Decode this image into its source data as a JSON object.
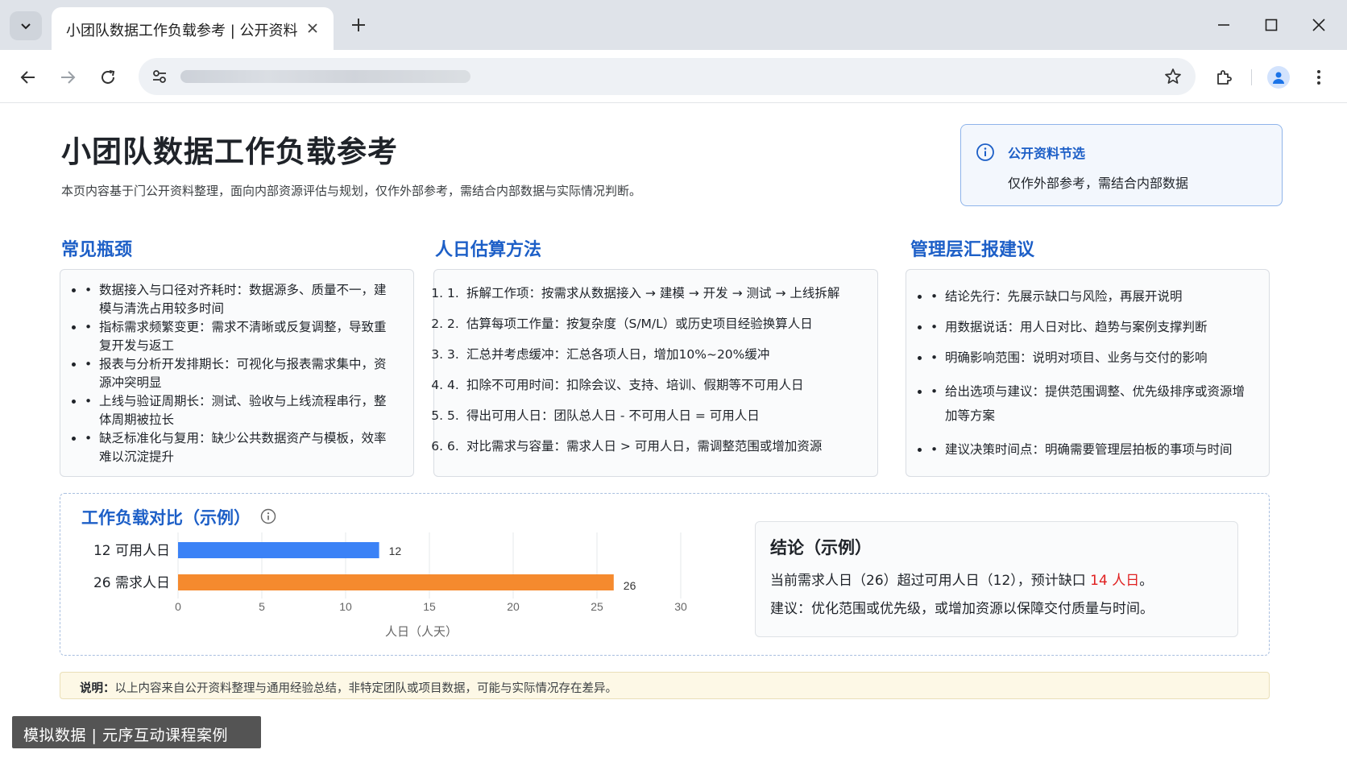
{
  "browser": {
    "tab_title": "小团队数据工作负载参考 | 公开资料",
    "icons": {
      "tab_search": "chevron-down-icon",
      "close_tab": "close-icon",
      "new_tab": "plus-icon",
      "back": "arrow-left-icon",
      "forward": "arrow-right-icon",
      "reload": "reload-icon",
      "site_info": "tune-icon",
      "bookmark": "star-icon",
      "extensions": "puzzle-icon",
      "profile": "person-icon",
      "menu": "more-vertical-icon",
      "minimize": "minimize-icon",
      "maximize": "maximize-icon",
      "close_window": "close-icon"
    }
  },
  "page": {
    "title": "小团队数据工作负载参考",
    "subtitle": "本页内容基于门公开资料整理，面向内部资源评估与规划，仅作外部参考，需结合内部数据与实际情况判断。",
    "info_box": {
      "heading": "公开资料节选",
      "text": "仅作外部参考，需结合内部数据"
    }
  },
  "sections": {
    "bottlenecks": {
      "title": "常见瓶颈",
      "items": [
        "数据接入与口径对齐耗时：数据源多、质量不一，建模与清洗占用较多时间",
        "指标需求频繁变更：需求不清晰或反复调整，导致重复开发与返工",
        "报表与分析开发排期长：可视化与报表需求集中，资源冲突明显",
        "上线与验证周期长：测试、验收与上线流程串行，整体周期被拉长",
        "缺乏标准化与复用：缺少公共数据资产与模板，效率难以沉淀提升"
      ]
    },
    "estimation": {
      "title": "人日估算方法",
      "items": [
        "拆解工作项：按需求从数据接入 → 建模 → 开发 → 测试 → 上线拆解",
        "估算每项工作量：按复杂度（S/M/L）或历史项目经验换算人日",
        "汇总并考虑缓冲：汇总各项人日，增加10%~20%缓冲",
        "扣除不可用时间：扣除会议、支持、培训、假期等不可用人日",
        "得出可用人日：团队总人日 - 不可用人日 = 可用人日",
        "对比需求与容量：需求人日 > 可用人日，需调整范围或增加资源"
      ]
    },
    "reporting": {
      "title": "管理层汇报建议",
      "items": [
        "结论先行：先展示缺口与风险，再展开说明",
        "用数据说话：用人日对比、趋势与案例支撑判断",
        "明确影响范围：说明对项目、业务与交付的影响",
        "给出选项与建议：提供范围调整、优先级排序或资源增加等方案",
        "建议决策时间点：明确需要管理层拍板的事项与时间"
      ]
    }
  },
  "chart_panel": {
    "title": "工作负载对比（示例）",
    "conclusion": {
      "title": "结论（示例）",
      "line1_prefix": "当前需求人日（26）超过可用人日（12），预计缺口 ",
      "line1_highlight": "14 人日",
      "line1_suffix": "。",
      "line2": "建议：优化范围或优先级，或增加资源以保障交付质量与时间。"
    }
  },
  "chart_data": {
    "type": "bar",
    "orientation": "horizontal",
    "categories": [
      "12  可用人日",
      "26  需求人日"
    ],
    "values": [
      12,
      26
    ],
    "colors": [
      "#3b82f6",
      "#f58a2e"
    ],
    "data_labels": [
      "12",
      "26"
    ],
    "xlabel": "人日（人天）",
    "ylabel": "",
    "xlim": [
      0,
      30
    ],
    "xticks": [
      0,
      5,
      10,
      15,
      20,
      25,
      30
    ],
    "grid": true
  },
  "note": {
    "label": "说明：",
    "text": "以上内容来自公开资料整理与通用经验总结，非特定团队或项目数据，可能与实际情况存在差异。"
  },
  "watermark": "模拟数据 | 元序互动课程案例"
}
